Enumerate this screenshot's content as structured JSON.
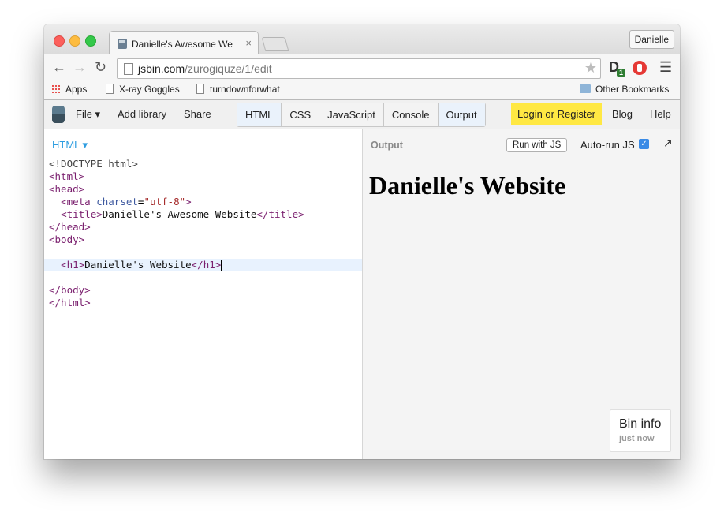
{
  "browser": {
    "tab_title": "Danielle's Awesome Website",
    "tab_close": "×",
    "profile": "Danielle",
    "url_host": "jsbin.com",
    "url_path": "/zurogiquze/1/edit",
    "extension_badge": "1",
    "bookmarks": [
      "Apps",
      "X-ray Goggles",
      "turndownforwhat"
    ],
    "other_bookmarks": "Other Bookmarks"
  },
  "jsbin": {
    "menu": [
      "File ▾",
      "Add library",
      "Share"
    ],
    "panels": [
      "HTML",
      "CSS",
      "JavaScript",
      "Console",
      "Output"
    ],
    "login": "Login or Register",
    "right_links": [
      "Blog",
      "Help"
    ]
  },
  "editor": {
    "label": "HTML ▾"
  },
  "output": {
    "label": "Output",
    "run_button": "Run with JS",
    "autorun": "Auto-run JS",
    "heading": "Danielle's Website",
    "bin_info_title": "Bin info",
    "bin_info_time": "just now"
  }
}
